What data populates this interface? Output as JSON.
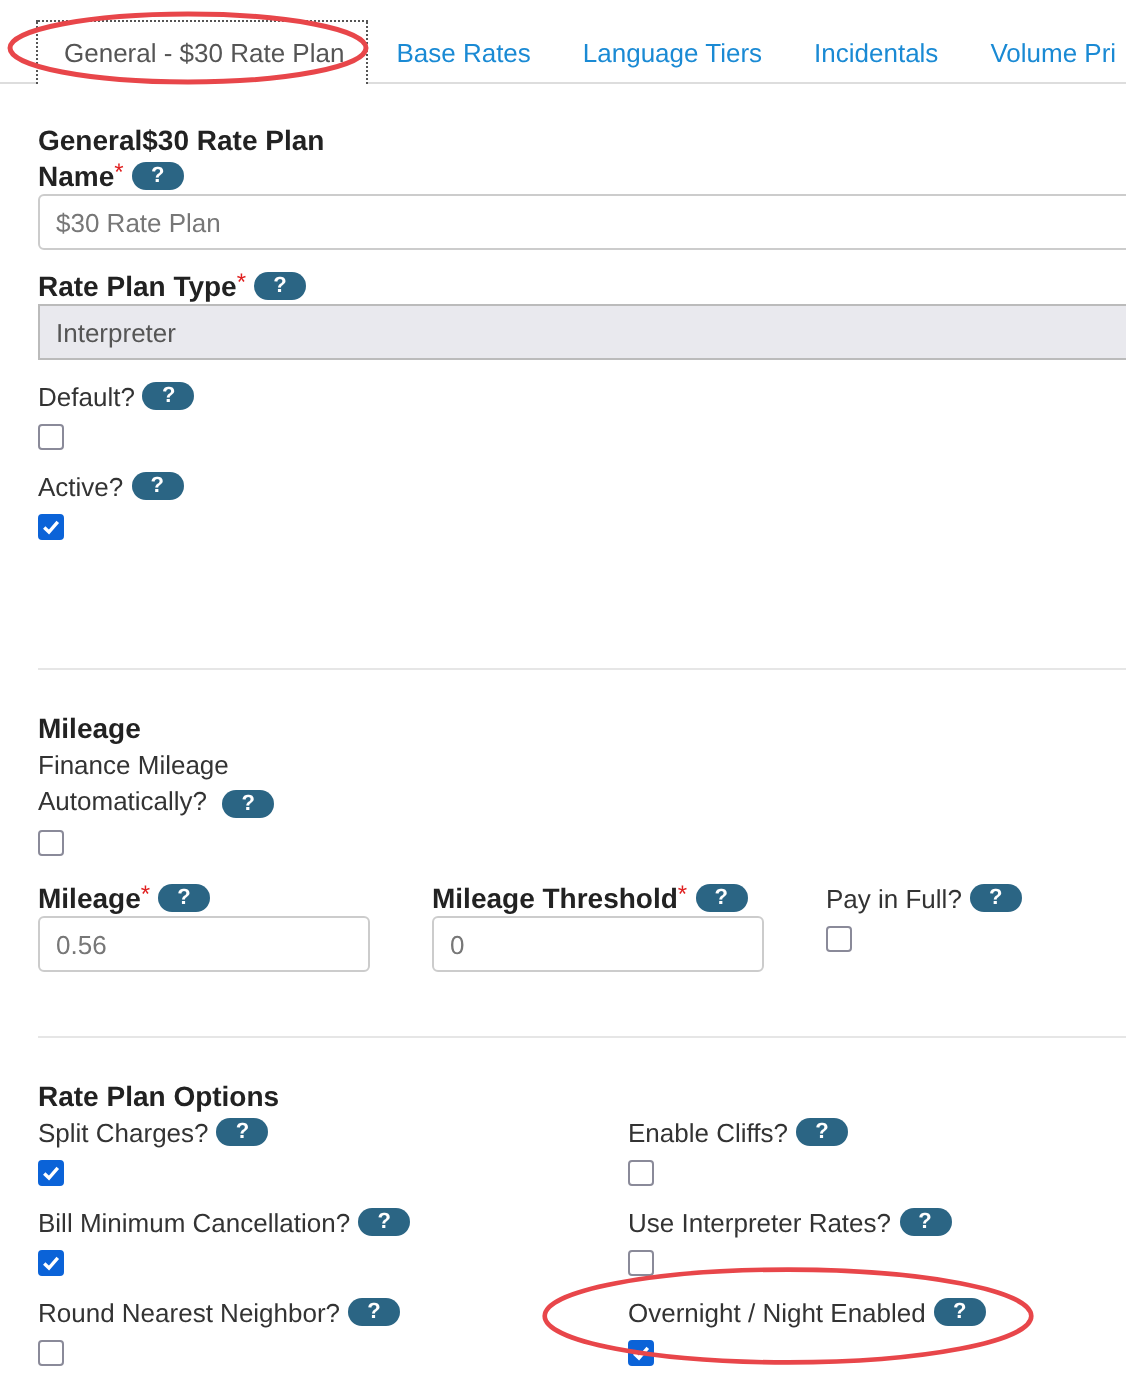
{
  "tabs": [
    {
      "label": "General - $30 Rate Plan",
      "selected": true,
      "circled": true
    },
    {
      "label": "Base Rates",
      "selected": false,
      "circled": false
    },
    {
      "label": "Language Tiers",
      "selected": false,
      "circled": false
    },
    {
      "label": "Incidentals",
      "selected": false,
      "circled": false
    },
    {
      "label": "Volume Pri",
      "selected": false,
      "circled": false
    }
  ],
  "general": {
    "heading": "General$30 Rate Plan",
    "fields": [
      {
        "kind": "input",
        "label": "Name",
        "required_mark": "*",
        "help": "?",
        "value": "$30 Rate Plan"
      },
      {
        "kind": "select",
        "label": "Rate Plan Type",
        "required_mark": "*",
        "help": "?",
        "value": "Interpreter"
      },
      {
        "kind": "checkbox",
        "label": "Default?",
        "help": "?",
        "checked": false
      },
      {
        "kind": "checkbox",
        "label": "Active?",
        "help": "?",
        "checked": true
      }
    ]
  },
  "mileage": {
    "heading": "Mileage",
    "auto": {
      "label": "Finance Mileage Automatically?",
      "help": "?",
      "checked": false
    },
    "fields": [
      {
        "kind": "input",
        "label": "Mileage",
        "required_mark": "*",
        "help": "?",
        "value": "0.56"
      },
      {
        "kind": "input",
        "label": "Mileage Threshold",
        "required_mark": "*",
        "help": "?",
        "value": "0"
      },
      {
        "kind": "checkbox",
        "label": "Pay in Full?",
        "help": "?",
        "checked": false
      }
    ]
  },
  "options": {
    "heading": "Rate Plan Options",
    "items": [
      {
        "label": "Split Charges?",
        "help": "?",
        "checked": true,
        "circled": false
      },
      {
        "label": "Enable Cliffs?",
        "help": "?",
        "checked": false,
        "circled": false
      },
      {
        "label": "Bill Minimum Cancellation?",
        "help": "?",
        "checked": true,
        "circled": false
      },
      {
        "label": "Use Interpreter Rates?",
        "help": "?",
        "checked": false,
        "circled": false
      },
      {
        "label": "Round Nearest Neighbor?",
        "help": "?",
        "checked": false,
        "circled": false
      },
      {
        "label": "Overnight / Night Enabled",
        "help": "?",
        "checked": true,
        "circled": true
      }
    ]
  }
}
